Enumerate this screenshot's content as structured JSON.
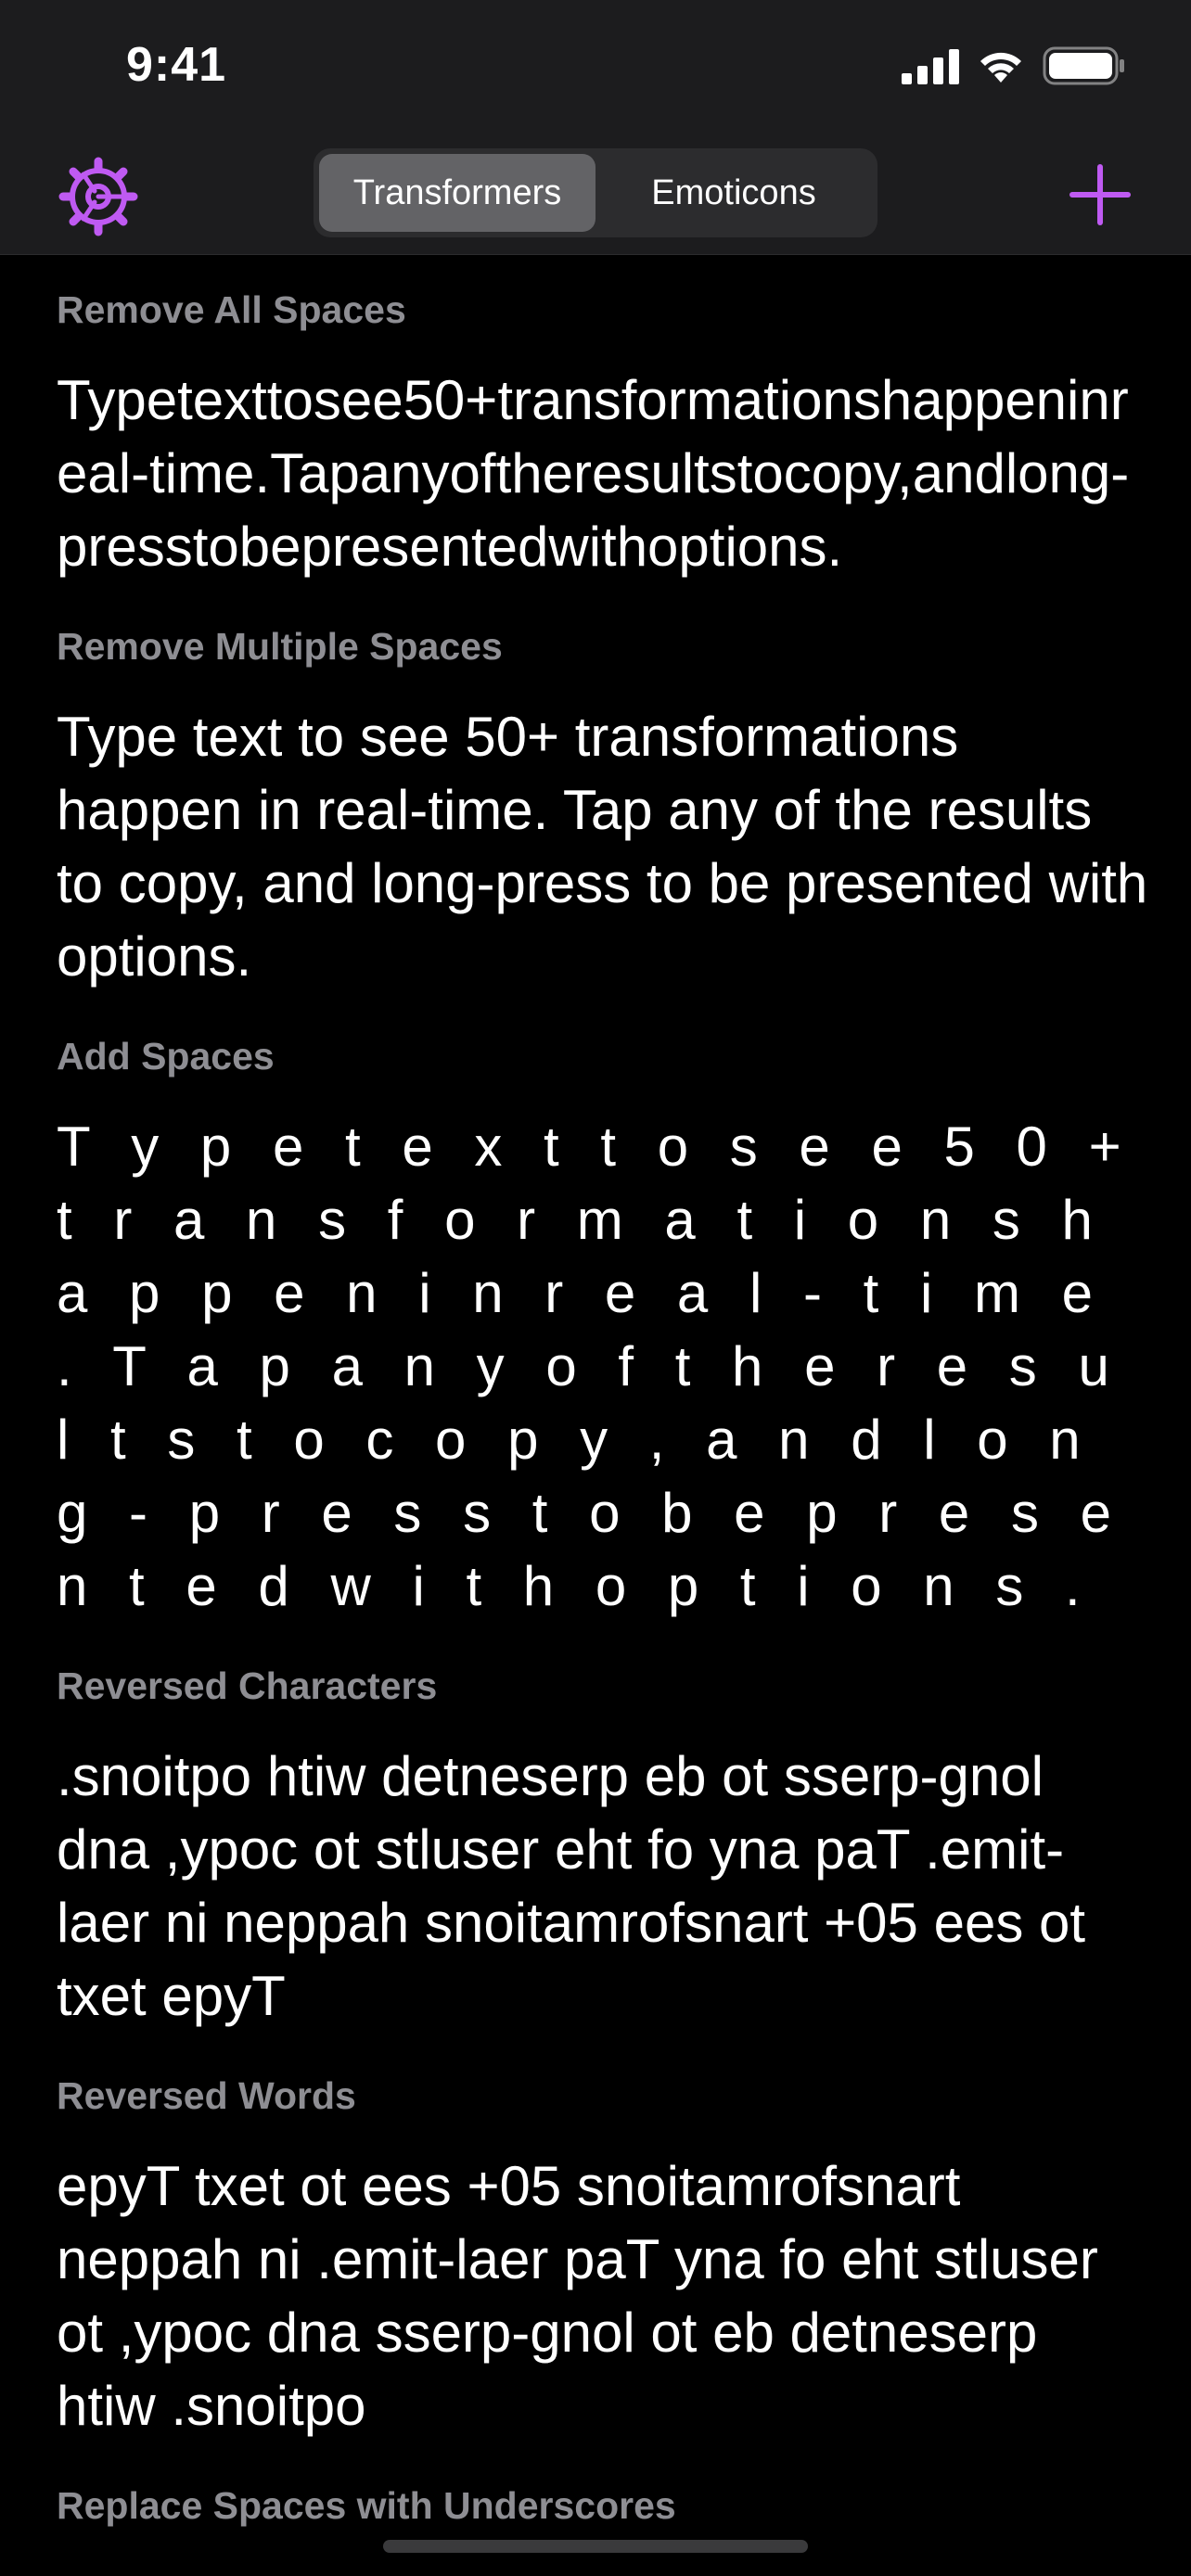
{
  "status_bar": {
    "time": "9:41"
  },
  "nav": {
    "tabs": [
      {
        "label": "Transformers",
        "selected": true
      },
      {
        "label": "Emoticons",
        "selected": false
      }
    ],
    "settings_icon": "gear-icon",
    "add_icon": "plus-icon",
    "accent_color": "#bf5af2"
  },
  "sections": [
    {
      "label": "Remove All Spaces",
      "text": "Typetexttosee50+transformationshappeninreal-time.Tapanyoftheresultstocopy,andlong-presstobepresentedwithoptions."
    },
    {
      "label": "Remove Multiple Spaces",
      "text": "Type text to see 50+ transformations happen in real-time. Tap any of the results to copy, and long-press to be presented with options."
    },
    {
      "label": "Add Spaces",
      "text": "T y p e   t e x t   t o   s e e   5 0 +   t r a n s f o r m a t i o n s   h a p p e n   i n   r e a l - t i m e .   T a p   a n y   o f   t h e   r e s u l t s   t o   c o p y ,   a n d   l o n g - p r e s s   t o   b e   p r e s e n t e d   w i t h   o p t i o n s ."
    },
    {
      "label": "Reversed Characters",
      "text": ".snoitpo htiw detneserp eb ot sserp-gnol dna ,ypoc ot stluser eht fo yna paT .emit-laer ni neppah snoitamrofsnart +05 ees ot txet epyT"
    },
    {
      "label": "Reversed Words",
      "text": "epyT txet ot ees +05 snoitamrofsnart neppah ni .emit-laer paT yna fo eht stluser ot ,ypoc dna sserp-gnol ot eb detneserp htiw .snoitpo"
    },
    {
      "label": "Replace Spaces with Underscores",
      "text": ""
    }
  ]
}
